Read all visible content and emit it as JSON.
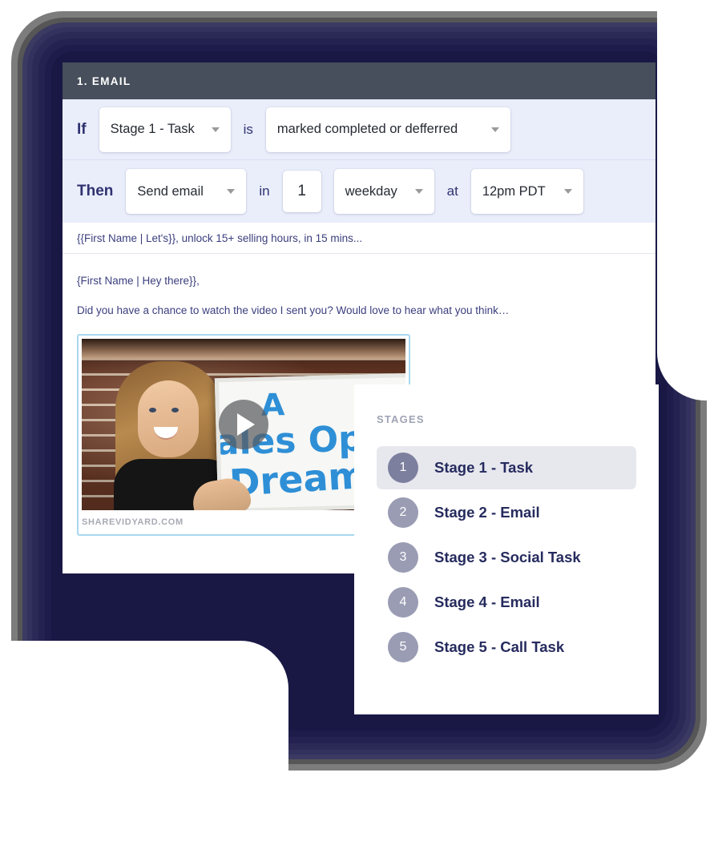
{
  "email_card": {
    "header_title": "1. EMAIL",
    "if_row": {
      "keyword": "If",
      "stage_select": "Stage 1 - Task",
      "connector": "is",
      "condition_select": "marked completed or defferred"
    },
    "then_row": {
      "keyword": "Then",
      "action_select": "Send email",
      "connector_in": "in",
      "delay_value": "1",
      "unit_select": "weekday",
      "connector_at": "at",
      "time_select": "12pm PDT"
    },
    "subject": "{{First Name | Let's}}, unlock 15+ selling hours, in 15 mins...",
    "body": {
      "greeting": "{First Name | Hey there}},",
      "paragraph": "Did you have a chance to watch the video I sent you? Would love to hear what you think…"
    },
    "video": {
      "whiteboard_line_1": "A",
      "whiteboard_line_2": "Sales Ops",
      "whiteboard_line_3": "Dream!",
      "caption": "SHAREVIDYARD.COM"
    }
  },
  "stages_panel": {
    "title": "STAGES",
    "items": [
      {
        "num": "1",
        "label": "Stage 1 - Task",
        "active": true
      },
      {
        "num": "2",
        "label": "Stage 2 - Email",
        "active": false
      },
      {
        "num": "3",
        "label": "Stage 3 - Social Task",
        "active": false
      },
      {
        "num": "4",
        "label": "Stage 4 - Email",
        "active": false
      },
      {
        "num": "5",
        "label": "Stage 5 - Call Task",
        "active": false
      }
    ]
  },
  "colors": {
    "header_bar": "#464f5b",
    "rule_row_bg": "#eaeefb",
    "accent_navy": "#262b5e",
    "frame_navy": "#191845",
    "stage_circle": "#9a9cb4",
    "stage_circle_active": "#7d7f9e",
    "stage_active_bg": "#e7e8ee",
    "video_border": "#a8d8ef"
  }
}
